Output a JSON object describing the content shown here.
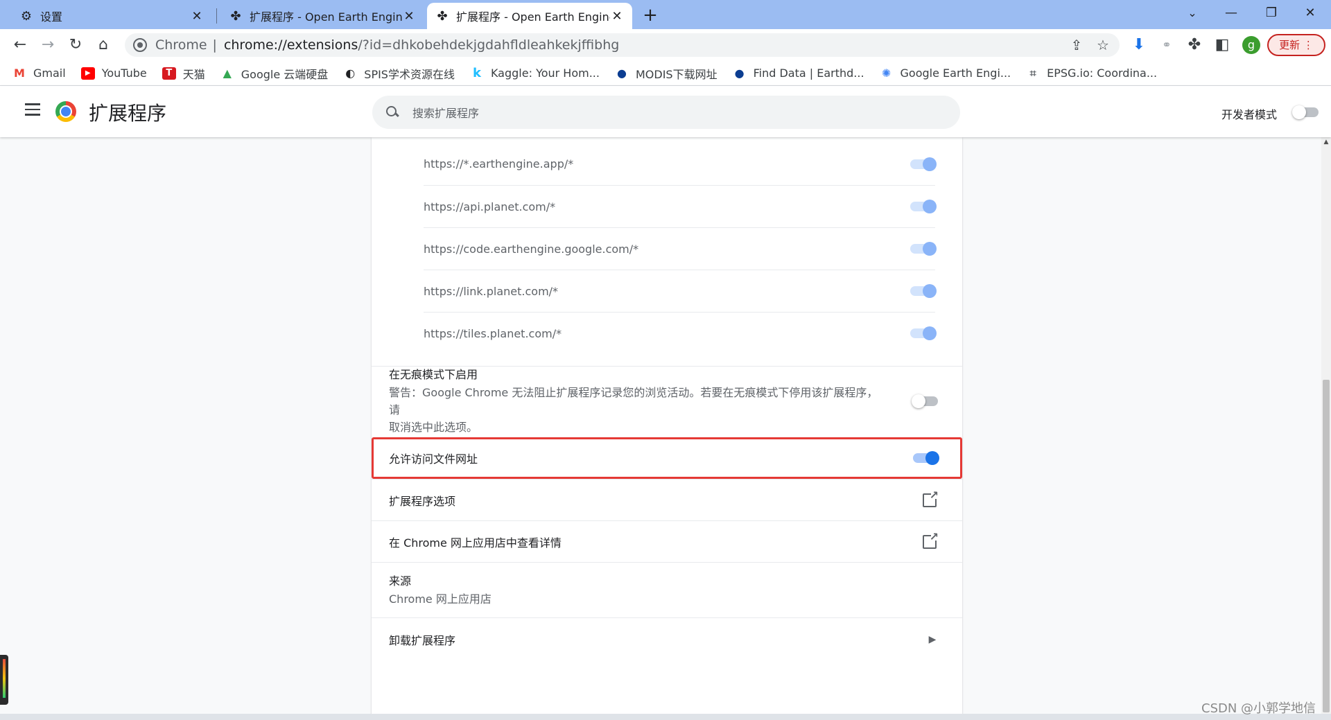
{
  "tabs": [
    {
      "title": "设置",
      "icon": "gear-icon"
    },
    {
      "title": "扩展程序 - Open Earth Engine",
      "icon": "puzzle-icon"
    },
    {
      "title": "扩展程序 - Open Earth Engine",
      "icon": "puzzle-icon"
    }
  ],
  "new_tab_glyph": "+",
  "window_controls": {
    "minimize": "—",
    "restore": "❐",
    "close": "✕"
  },
  "omnibox": {
    "origin_label": "Chrome",
    "url_host": "chrome://extensions",
    "url_rest": "/?id=dhkobehdekjgdahfldleahkekjffibhg"
  },
  "profile_initial": "g",
  "update_label": "更新",
  "bookmarks": [
    {
      "label": "Gmail",
      "icon": "gmail-icon",
      "color": "#ea4335",
      "glyph": "M"
    },
    {
      "label": "YouTube",
      "icon": "youtube-icon",
      "color": "#ff0000",
      "glyph": "▶"
    },
    {
      "label": "天猫",
      "icon": "tmall-icon",
      "color": "#d71920",
      "glyph": "T"
    },
    {
      "label": "Google 云端硬盘",
      "icon": "drive-icon",
      "color": "#34a853",
      "glyph": "▲"
    },
    {
      "label": "SPIS学术资源在线",
      "icon": "spis-icon",
      "color": "#202124",
      "glyph": "◐"
    },
    {
      "label": "Kaggle: Your Hom...",
      "icon": "kaggle-icon",
      "color": "#20beff",
      "glyph": "k"
    },
    {
      "label": "MODIS下载网址",
      "icon": "nasa-icon",
      "color": "#0b3d91",
      "glyph": "●"
    },
    {
      "label": "Find Data | Earthd...",
      "icon": "nasa-icon",
      "color": "#0b3d91",
      "glyph": "●"
    },
    {
      "label": "Google Earth Engi...",
      "icon": "earth-engine-icon",
      "color": "#4285f4",
      "glyph": "✺"
    },
    {
      "label": "EPSG.io: Coordina...",
      "icon": "epsg-icon",
      "color": "#5f6368",
      "glyph": "⌗"
    }
  ],
  "header": {
    "title": "扩展程序",
    "search_placeholder": "搜索扩展程序",
    "devmode_label": "开发者模式",
    "devmode_on": false
  },
  "site_access": [
    {
      "url": "https://*.earthengine.app/*",
      "enabled": true
    },
    {
      "url": "https://api.planet.com/*",
      "enabled": true
    },
    {
      "url": "https://code.earthengine.google.com/*",
      "enabled": true
    },
    {
      "url": "https://link.planet.com/*",
      "enabled": true
    },
    {
      "url": "https://tiles.planet.com/*",
      "enabled": true
    }
  ],
  "incognito": {
    "title": "在无痕模式下启用",
    "warning_line1": "警告：Google Chrome 无法阻止扩展程序记录您的浏览活动。若要在无痕模式下停用该扩展程序，请",
    "warning_line2": "取消选中此选项。",
    "enabled": false
  },
  "file_urls": {
    "title": "允许访问文件网址",
    "enabled": true
  },
  "extension_options": {
    "title": "扩展程序选项"
  },
  "webstore_details": {
    "title": "在 Chrome 网上应用店中查看详情"
  },
  "source": {
    "title": "来源",
    "value": "Chrome 网上应用店"
  },
  "remove": {
    "title": "卸载扩展程序"
  },
  "watermark": "CSDN @小郭学地信",
  "colors": {
    "accent": "#1a73e8",
    "highlight": "#e53935",
    "tabstrip": "#9bbcf2"
  }
}
